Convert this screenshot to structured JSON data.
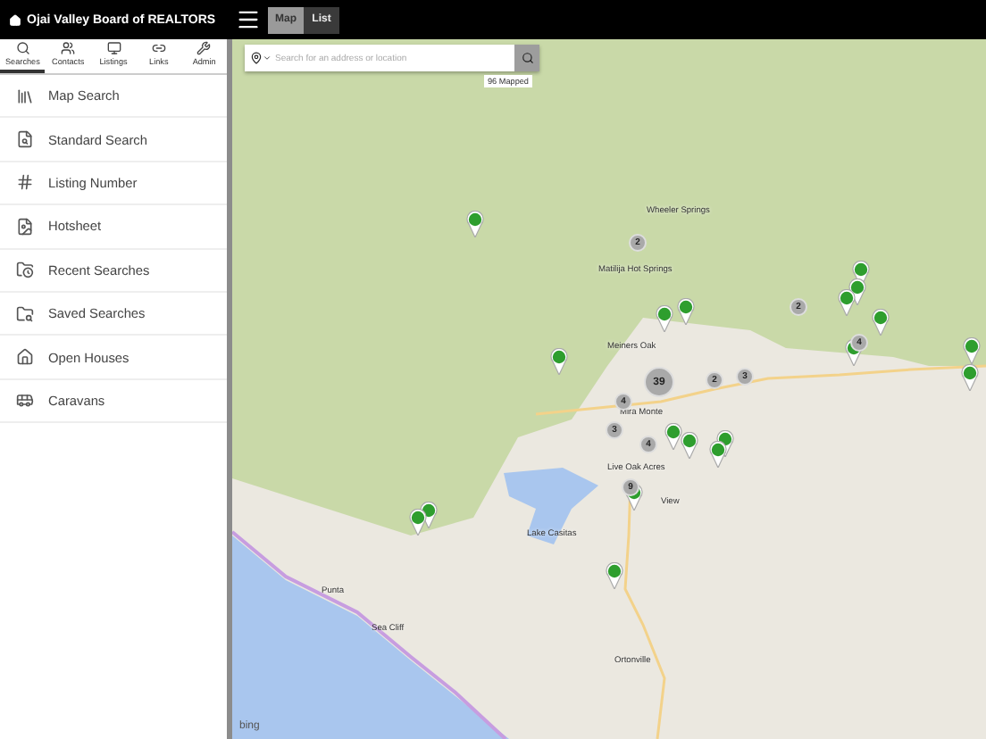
{
  "header": {
    "title": "Ojai Valley Board of REALTORS",
    "view_toggle": [
      {
        "label": "Map",
        "selected": true
      },
      {
        "label": "List",
        "selected": false
      }
    ]
  },
  "sidebar": {
    "tabs": [
      {
        "label": "Searches",
        "selected": true
      },
      {
        "label": "Contacts",
        "selected": false
      },
      {
        "label": "Listings",
        "selected": false
      },
      {
        "label": "Links",
        "selected": false
      },
      {
        "label": "Admin",
        "selected": false
      }
    ],
    "items": [
      "Map Search",
      "Standard Search",
      "Listing Number",
      "Hotsheet",
      "Recent Searches",
      "Saved Searches",
      "Open Houses",
      "Caravans"
    ]
  },
  "map": {
    "search": {
      "placeholder": "Search for an address or location"
    },
    "mapped_count": "96 Mapped",
    "places": [
      "Wheeler Springs",
      "Matilija Hot Springs",
      "Meiners Oak",
      "Mira Monte",
      "Live Oak Acres",
      "View",
      "Lake Casitas",
      "Punta",
      "Sea Cliff",
      "Ortonville"
    ],
    "clusters": [
      "2",
      "2",
      "4",
      "39",
      "2",
      "3",
      "4",
      "3",
      "4",
      "9"
    ],
    "attribution": "bing"
  }
}
